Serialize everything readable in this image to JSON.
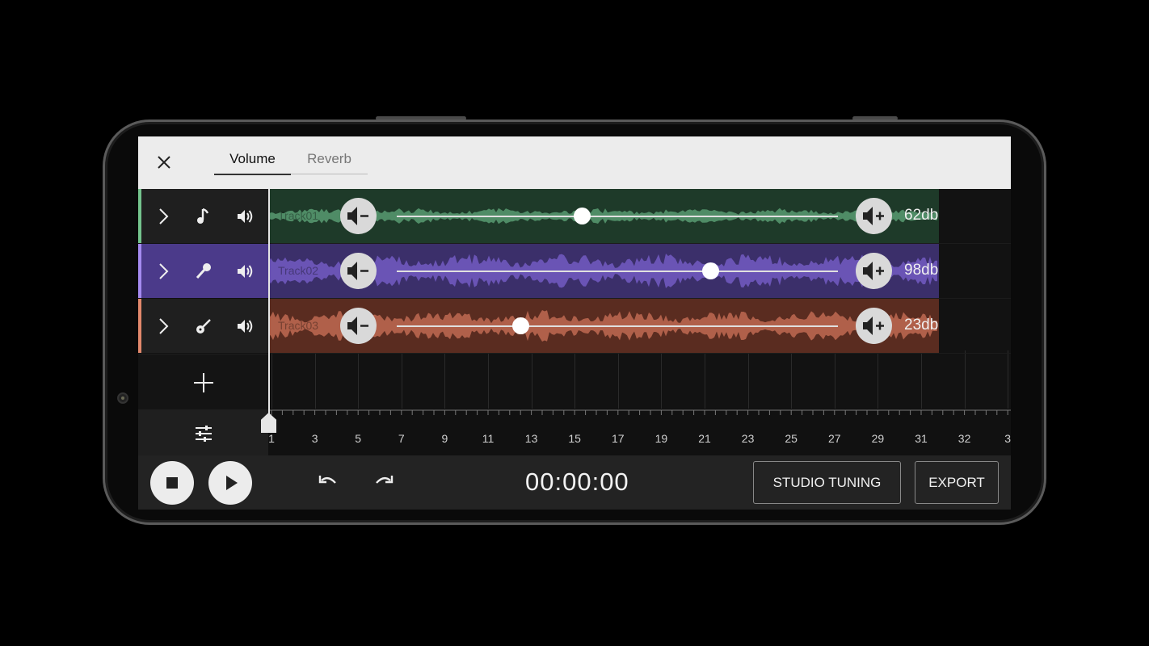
{
  "tabs": [
    {
      "label": "Volume",
      "active": true
    },
    {
      "label": "Reverb",
      "active": false
    }
  ],
  "tracks": [
    {
      "name": "Track01",
      "instrument_icon": "music-note-icon",
      "volume_db": "62db",
      "volume_level": 0.42,
      "color": "#74c48d",
      "bg": "#1e3a29",
      "wave": "#4f8c66"
    },
    {
      "name": "Track02",
      "instrument_icon": "microphone-icon",
      "volume_db": "98db",
      "volume_level": 0.71,
      "color": "#a58bf0",
      "bg": "#3b2f6a",
      "wave": "#6a54b5"
    },
    {
      "name": "Track03",
      "instrument_icon": "guitar-icon",
      "volume_db": "23db",
      "volume_level": 0.28,
      "color": "#e2886c",
      "bg": "#5a2c20",
      "wave": "#b0604a"
    }
  ],
  "ruler_labels": [
    "1",
    "3",
    "5",
    "7",
    "9",
    "11",
    "13",
    "15",
    "17",
    "19",
    "21",
    "23",
    "25",
    "27",
    "29",
    "31",
    "32",
    "3"
  ],
  "time": "00:00:00",
  "buttons": {
    "studio_tuning": "STUDIO TUNING",
    "export": "EXPORT"
  }
}
